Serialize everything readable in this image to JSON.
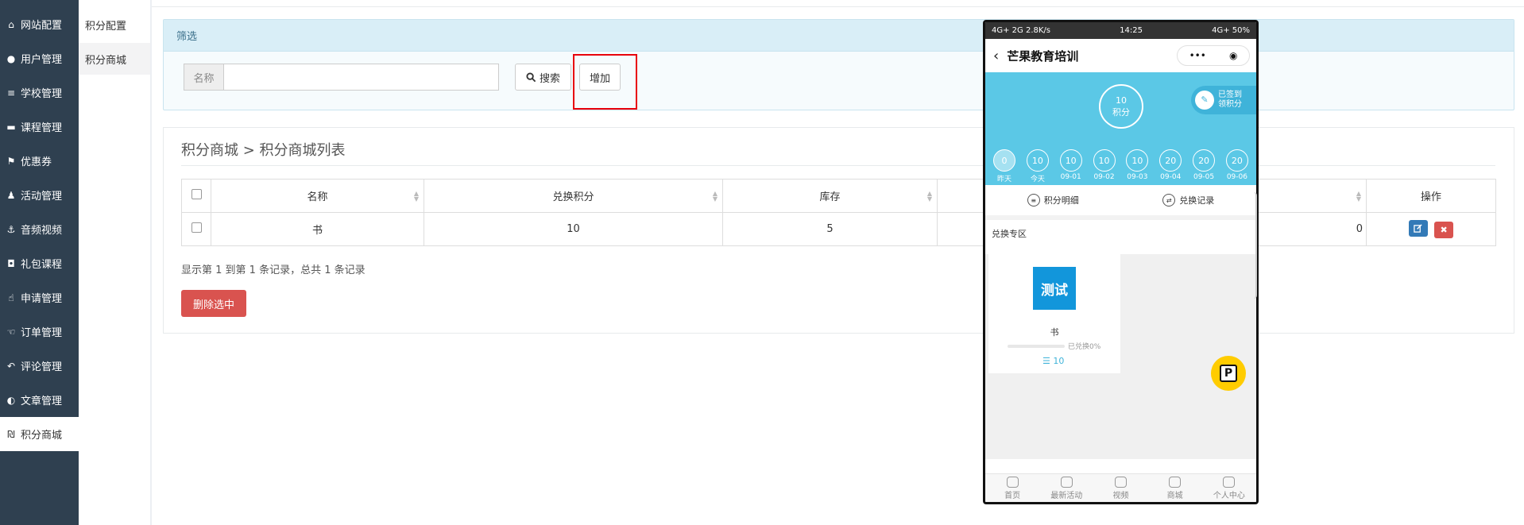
{
  "sidebar": {
    "items": [
      {
        "label": "网站配置",
        "icon": "home-icon",
        "glyph": "⌂"
      },
      {
        "label": "用户管理",
        "icon": "user-icon",
        "glyph": "●"
      },
      {
        "label": "学校管理",
        "icon": "list-icon",
        "glyph": "≡"
      },
      {
        "label": "课程管理",
        "icon": "cart-icon",
        "glyph": "▬"
      },
      {
        "label": "优惠券",
        "icon": "flag-icon",
        "glyph": "⚑"
      },
      {
        "label": "活动管理",
        "icon": "group-icon",
        "glyph": "♟"
      },
      {
        "label": "音频视频",
        "icon": "anchor-icon",
        "glyph": "⚓"
      },
      {
        "label": "礼包课程",
        "icon": "gift-icon",
        "glyph": "◘"
      },
      {
        "label": "申请管理",
        "icon": "hand-pointer-icon",
        "glyph": "☝"
      },
      {
        "label": "订单管理",
        "icon": "thumbs-up-icon",
        "glyph": "☜"
      },
      {
        "label": "评论管理",
        "icon": "reply-icon",
        "glyph": "↶"
      },
      {
        "label": "文章管理",
        "icon": "adjust-icon",
        "glyph": "◐"
      },
      {
        "label": "积分商城",
        "icon": "points-icon",
        "glyph": "₪"
      }
    ]
  },
  "submenu": {
    "items": [
      {
        "label": "积分配置"
      },
      {
        "label": "积分商城"
      }
    ]
  },
  "filter": {
    "heading": "筛选",
    "name_label": "名称",
    "name_value": "",
    "search_label": "搜索",
    "add_label": "增加"
  },
  "panel": {
    "title": "积分商城 > 积分商城列表",
    "columns": [
      "名称",
      "兑换积分",
      "库存",
      "操作"
    ],
    "rows": [
      {
        "name": "书",
        "points": "10",
        "stock": "5",
        "hidden_val": "0"
      }
    ],
    "pager": "显示第 1 到第 1 条记录，总共 1 条记录",
    "delete_selected": "删除选中"
  },
  "phone": {
    "status_left": "4G+ 2G 2.8K/s",
    "status_time": "14:25",
    "status_right": "4G+ 50%",
    "title": "芒果教育培训",
    "capsule_more": "•••",
    "capsule_close": "◉",
    "points_value": "10",
    "points_label": "积分",
    "signed_line1": "已签到",
    "signed_line2": "领积分",
    "days": [
      {
        "value": "0",
        "label": "昨天"
      },
      {
        "value": "10",
        "label": "今天"
      },
      {
        "value": "10",
        "label": "09-01"
      },
      {
        "value": "10",
        "label": "09-02"
      },
      {
        "value": "10",
        "label": "09-03"
      },
      {
        "value": "20",
        "label": "09-04"
      },
      {
        "value": "20",
        "label": "09-05"
      },
      {
        "value": "20",
        "label": "09-06"
      }
    ],
    "tool_detail": "积分明细",
    "tool_record": "兑换记录",
    "zone_title": "兑换专区",
    "product": {
      "image_text": "测试",
      "name": "书",
      "percent": "已兑换0%",
      "points": "10"
    },
    "tabs": [
      "首页",
      "最新活动",
      "视频",
      "商城",
      "个人中心"
    ]
  }
}
